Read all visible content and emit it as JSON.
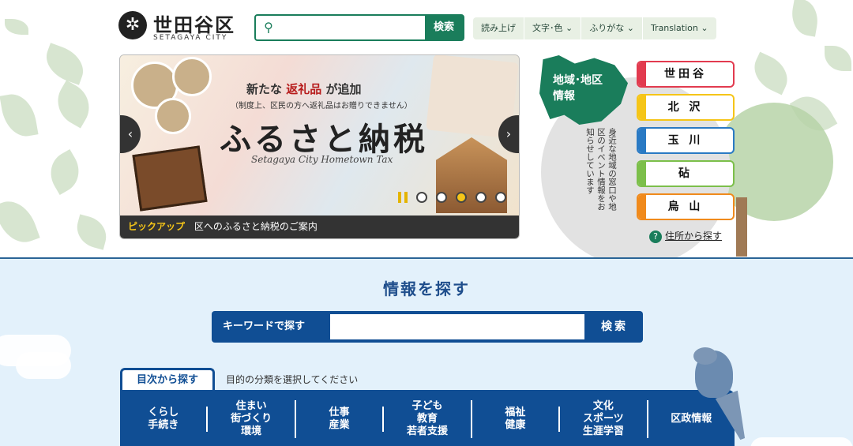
{
  "header": {
    "logo_mark": "✲",
    "logo_name": "世田谷区",
    "logo_en": "SETAGAYA CITY",
    "search_icon": "search-icon",
    "search_placeholder": "",
    "search_button": "検索",
    "tools": [
      "読み上げ",
      "文字･色 ⌄",
      "ふりがな ⌄",
      "Translation ⌄"
    ]
  },
  "slider": {
    "subtitle_pre": "新たな",
    "subtitle_em": "返礼品",
    "subtitle_post": "が追加",
    "note": "（制度上、区民の方へ返礼品はお贈りできません）",
    "title": "ふるさと納税",
    "title_en": "Setagaya City Hometown Tax",
    "prev": "‹",
    "next": "›",
    "dot_count": 5,
    "active_dot": 3,
    "caption_pick": "ピックアップ",
    "caption_text": "区へのふるさと納税のご案内"
  },
  "area": {
    "map_label_1": "地域･地区",
    "map_label_2": "情報",
    "description": "身近な地域の窓口や地区のイベント情報をお知らせしています",
    "buttons": [
      {
        "label": "世田谷",
        "color": "#e23b4f"
      },
      {
        "label": "北 沢",
        "color": "#f5c518"
      },
      {
        "label": "玉 川",
        "color": "#2a7ac4"
      },
      {
        "label": "砧",
        "color": "#7cbf4a"
      },
      {
        "label": "烏 山",
        "color": "#f08a1c"
      }
    ],
    "address_link_icon": "?",
    "address_link": "住所から探す"
  },
  "find": {
    "title": "情報を探す",
    "keyword_label": "キーワードで探す",
    "keyword_placeholder": "",
    "keyword_button": "検索",
    "tab_active": "目次から探す",
    "tab_hint": "目的の分類を選択してください",
    "categories": [
      "くらし\n手続き",
      "住まい\n街づくり\n環境",
      "仕事\n産業",
      "子ども\n教育\n若者支援",
      "福祉\n健康",
      "文化\nスポーツ\n生涯学習",
      "区政情報"
    ]
  }
}
